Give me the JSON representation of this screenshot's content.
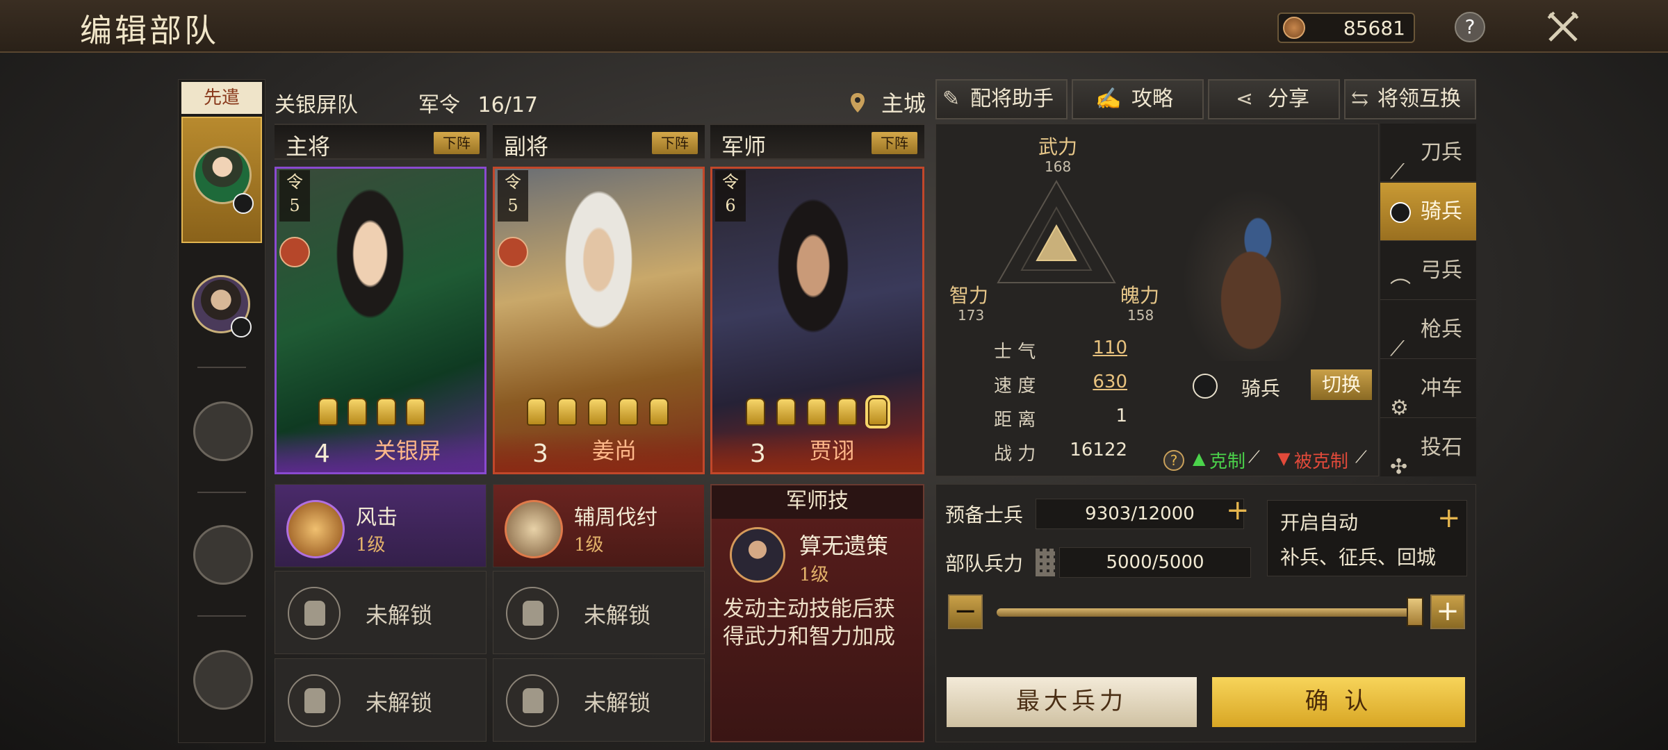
{
  "header": {
    "title": "编辑部队",
    "currency_value": "85681",
    "help_symbol": "?"
  },
  "sidebar": {
    "vanguard_tab": "先遣"
  },
  "team": {
    "name": "关银屏队",
    "order_label": "军令",
    "order_value": "16/17",
    "city_label": "主城"
  },
  "columns": [
    {
      "label": "主将",
      "remove_label": "下阵"
    },
    {
      "label": "副将",
      "remove_label": "下阵"
    },
    {
      "label": "军师",
      "remove_label": "下阵"
    }
  ],
  "cards": [
    {
      "token_label": "令",
      "token_cost": "5",
      "level": "4",
      "name": "关银屏"
    },
    {
      "token_label": "令",
      "token_cost": "5",
      "level": "3",
      "name": "姜尚"
    },
    {
      "token_label": "令",
      "token_cost": "6",
      "level": "3",
      "name": "贾诩"
    }
  ],
  "skills": [
    {
      "name": "风击",
      "level": "1级"
    },
    {
      "name": "辅周伐纣",
      "level": "1级"
    }
  ],
  "locked_slot_label": "未解锁",
  "tactic": {
    "header": "军师技",
    "name": "算无遗策",
    "level": "1级",
    "description_line1": "发动主动技能后获",
    "description_line2": "得武力和智力加成"
  },
  "toolbar": {
    "assist": "配将助手",
    "guide": "攻略",
    "share": "分享",
    "swap": "将领互换"
  },
  "stats": {
    "force_label": "武力",
    "force_value": "168",
    "intel_label": "智力",
    "intel_value": "173",
    "charm_label": "魄力",
    "charm_value": "158"
  },
  "attributes": [
    {
      "label": "士 气",
      "value": "110"
    },
    {
      "label": "速 度",
      "value": "630"
    },
    {
      "label": "距 离",
      "value": "1"
    },
    {
      "label": "战 力",
      "value": "16122"
    }
  ],
  "unit": {
    "type_label": "骑兵",
    "switch_label": "切换",
    "counter_label": "克制",
    "countered_label": "被克制",
    "help_symbol": "?"
  },
  "troop_types": [
    "刀兵",
    "骑兵",
    "弓兵",
    "枪兵",
    "冲车",
    "投石"
  ],
  "troop_selected_index": 1,
  "reserve": {
    "label": "预备士兵",
    "value": "9303/12000"
  },
  "strength": {
    "label": "部队兵力",
    "value": "5000/5000"
  },
  "auto": {
    "title": "开启自动",
    "options": "补兵、征兵、回城"
  },
  "slider_fraction": 1.0,
  "buttons": {
    "max": "最大兵力",
    "confirm": "确 认",
    "minus": "−",
    "plus": "+"
  },
  "colors": {
    "gold": "#e6b64e",
    "purple_card": "#7a3fb5",
    "red_card": "#c2472a",
    "counter_green": "#4bd34b",
    "countered_red": "#e24a3a"
  }
}
